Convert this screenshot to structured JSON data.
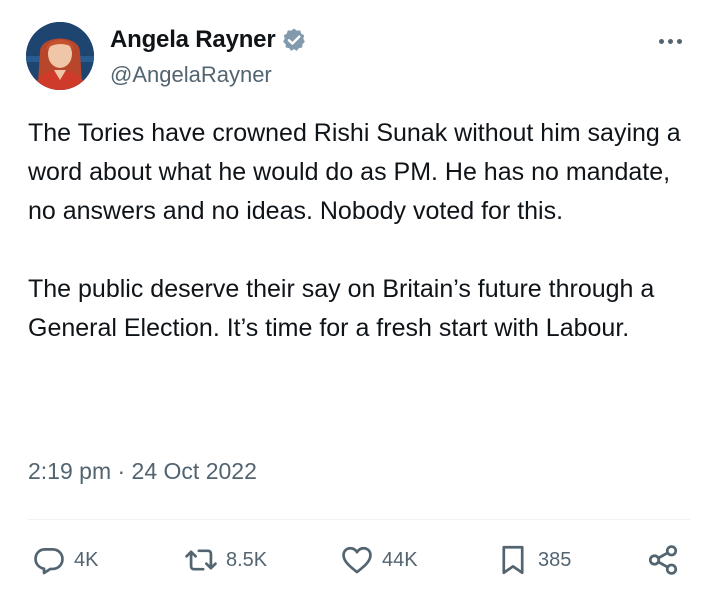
{
  "tweet": {
    "author_name": "Angela Rayner",
    "author_handle": "@AngelaRayner",
    "text_paragraph_1": "The Tories have crowned Rishi Sunak without him saying a word about what he would do as PM. He has no mandate, no answers and no ideas. Nobody voted for this.",
    "text_paragraph_2": "The public deserve their say on Britain’s future through a General Election. It’s time for a fresh start with Labour.",
    "timestamp": "2:19 pm · 24 Oct 2022"
  },
  "actions": {
    "replies": "4K",
    "reposts": "8.5K",
    "likes": "44K",
    "bookmarks": "385"
  },
  "icons": {
    "verified": "verified-badge-icon",
    "more": "more-options-icon",
    "reply": "reply-icon",
    "repost": "repost-icon",
    "like": "like-icon",
    "bookmark": "bookmark-icon",
    "share": "share-icon"
  },
  "colors": {
    "text_primary": "#0f1419",
    "text_secondary": "#536471",
    "divider": "#eff3f4",
    "verified_badge": "#829aab"
  }
}
